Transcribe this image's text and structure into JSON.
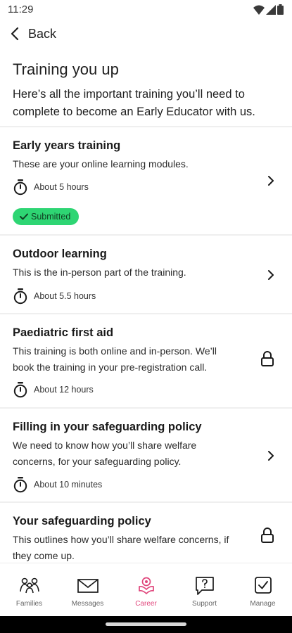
{
  "status_bar": {
    "time": "11:29"
  },
  "header": {
    "back_label": "Back"
  },
  "page": {
    "title": "Training you up",
    "intro": "Here’s all the important training you’ll need to complete to become an Early Educator with us."
  },
  "trainings": [
    {
      "title": "Early years training",
      "description": "These are your online learning modules.",
      "duration": "About 5 hours",
      "status": "Submitted",
      "action": "chevron-right-icon"
    },
    {
      "title": "Outdoor learning",
      "description": "This is the in-person part of the training.",
      "duration": "About 5.5 hours",
      "action": "chevron-right-icon"
    },
    {
      "title": "Paediatric first aid",
      "description": "This training is both online and in-person. We’ll book the training in your pre-registration call.",
      "duration": "About 12 hours",
      "action": "lock-icon"
    },
    {
      "title": "Filling in your safeguarding policy",
      "description": "We need to know how you’ll share welfare concerns, for your safeguarding policy.",
      "duration": "About 10 minutes",
      "action": "chevron-right-icon"
    },
    {
      "title": "Your safeguarding policy",
      "description": "This outlines how you’ll share welfare concerns, if they come up.",
      "action": "lock-icon"
    }
  ],
  "nav": {
    "items": [
      {
        "label": "Families",
        "icon": "families-icon"
      },
      {
        "label": "Messages",
        "icon": "envelope-icon"
      },
      {
        "label": "Career",
        "icon": "career-icon",
        "active": true
      },
      {
        "label": "Support",
        "icon": "help-bubble-icon"
      },
      {
        "label": "Manage",
        "icon": "checkbox-icon"
      }
    ]
  },
  "colors": {
    "accent": "#e0457b",
    "badge_green": "#2ed573"
  }
}
